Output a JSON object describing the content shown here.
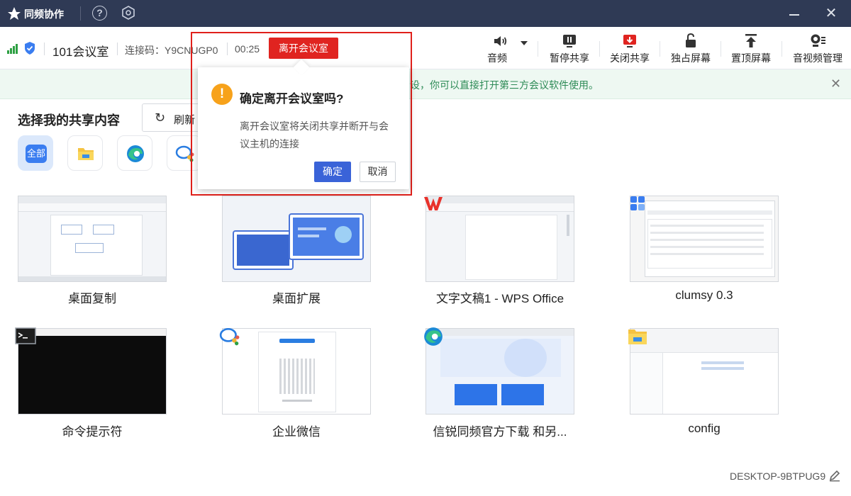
{
  "titlebar": {
    "app_name": "同频协作",
    "help_glyph": "?",
    "icons": [
      "app-logo-icon",
      "help-icon",
      "settings-icon",
      "minimize-icon",
      "close-icon"
    ]
  },
  "toolbar": {
    "room_name": "101会议室",
    "connection_code": "连接码：Y9CNUGP0",
    "timer": "00:25",
    "leave_label": "离开会议室",
    "tools": [
      {
        "label": "音频",
        "icon": "speaker-icon"
      },
      {
        "label": "暂停共享",
        "icon": "pause-share-icon"
      },
      {
        "label": "关闭共享",
        "icon": "stop-share-icon"
      },
      {
        "label": "独占屏幕",
        "icon": "lock-screen-icon"
      },
      {
        "label": "置顶屏幕",
        "icon": "pin-top-icon"
      },
      {
        "label": "音视频管理",
        "icon": "av-manage-icon"
      }
    ],
    "status_colors": {
      "signal": "#2ea043",
      "shield": "#3a7df0",
      "leave": "#e02420"
    }
  },
  "notice": {
    "text": "设，你可以直接打开第三方会议软件使用。"
  },
  "share": {
    "title": "选择我的共享内容",
    "refresh_label": "刷新",
    "filters": [
      {
        "label": "全部",
        "icon": "all-filter-icon",
        "active": true
      },
      {
        "label": "",
        "icon": "file-explorer-icon",
        "active": false
      },
      {
        "label": "",
        "icon": "edge-icon",
        "active": false
      },
      {
        "label": "",
        "icon": "wecom-icon",
        "active": false
      }
    ],
    "items": [
      {
        "label": "桌面复制",
        "icon": "desktop-thumbnail"
      },
      {
        "label": "桌面扩展",
        "icon": "extend-desktop-thumbnail"
      },
      {
        "label": "文字文稿1 - WPS Office",
        "icon": "wps-icon"
      },
      {
        "label": "clumsy 0.3",
        "icon": "clumsy-icon"
      },
      {
        "label": "命令提示符",
        "icon": "cmd-icon"
      },
      {
        "label": "企业微信",
        "icon": "wecom-icon"
      },
      {
        "label": "信锐同频官方下载 和另...",
        "icon": "edge-icon"
      },
      {
        "label": "config",
        "icon": "folder-icon"
      }
    ]
  },
  "dialog": {
    "title": "确定离开会议室吗?",
    "body": "离开会议室将关闭共享并断开与会议主机的连接",
    "ok_label": "确定",
    "cancel_label": "取消",
    "warn_glyph": "!",
    "accent": "#3a63d8",
    "highlight": "#e0201b"
  },
  "footer": {
    "device_name": "DESKTOP-9BTPUG9"
  }
}
